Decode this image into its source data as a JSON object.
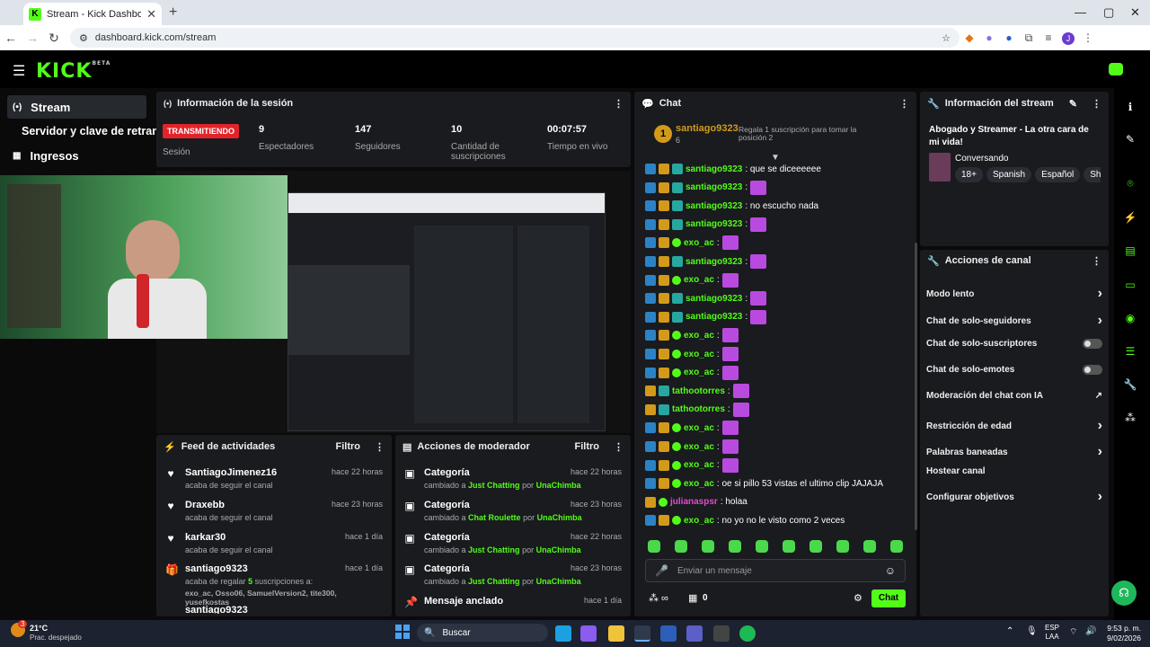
{
  "browser": {
    "tab_title": "Stream - Kick Dashboard",
    "url": "dashboard.kick.com/stream"
  },
  "kick": {
    "logo": "KICK",
    "logo_sup": "BETA"
  },
  "sidebar": {
    "items": [
      {
        "label": "Stream",
        "icon": "broadcast-icon"
      },
      {
        "label": "Servidor y clave de retransm",
        "icon": "server-icon"
      },
      {
        "label": "Ingresos",
        "icon": "chart-icon"
      }
    ]
  },
  "session": {
    "title": "Información de la sesión",
    "status": "TRANSMITIENDO",
    "status_label": "Sesión",
    "stats": [
      {
        "value": "9",
        "label": "Espectadores"
      },
      {
        "value": "147",
        "label": "Seguidores"
      },
      {
        "value": "10",
        "label": "Cantidad de suscripciones"
      },
      {
        "value": "00:07:57",
        "label": "Tiempo en vivo"
      }
    ]
  },
  "activity": {
    "title": "Feed de actividades",
    "filter": "Filtro",
    "items": [
      {
        "name": "SantiagoJimenez16",
        "sub": "acaba de seguir el canal",
        "time": "hace 22 horas"
      },
      {
        "name": "Draxebb",
        "sub": "acaba de seguir el canal",
        "time": "hace 23 horas"
      },
      {
        "name": "karkar30",
        "sub": "acaba de seguir el canal",
        "time": "hace 1 día"
      },
      {
        "name": "santiago9323",
        "sub": "acaba de regalar",
        "sub_count": "5",
        "sub_rest": "suscripciones a:",
        "gifted": "exo_ac, Osso06, SamuelVersion2, tite300, yusefkostas",
        "time": "hace 1 día"
      },
      {
        "name": "santiago9323"
      }
    ]
  },
  "modactions": {
    "title": "Acciones de moderador",
    "filter": "Filtro",
    "items": [
      {
        "name": "Categoría",
        "pre": "cambiado a",
        "what": "Just Chatting",
        "by": "por",
        "who": "UnaChimba",
        "time": "hace 22 horas"
      },
      {
        "name": "Categoría",
        "pre": "cambiado a",
        "what": "Chat Roulette",
        "by": "por",
        "who": "UnaChimba",
        "time": "hace 23 horas"
      },
      {
        "name": "Categoría",
        "pre": "cambiado a",
        "what": "Just Chatting",
        "by": "por",
        "who": "UnaChimba",
        "time": "hace 22 horas"
      },
      {
        "name": "Categoría",
        "pre": "cambiado a",
        "what": "Just Chatting",
        "by": "por",
        "who": "UnaChimba",
        "time": "hace 23 horas"
      },
      {
        "name": "Mensaje anclado",
        "time": "hace 1 día"
      }
    ]
  },
  "chat": {
    "title": "Chat",
    "top_rank": "1",
    "top_user": "santiago9323",
    "top_count": "6",
    "gift_prompt": "Regala 1 suscripción para tomar la posición 2",
    "messages": [
      {
        "user": "santiago9323",
        "text": ": que se diceeeeee",
        "color": "#53fc18"
      },
      {
        "user": "santiago9323",
        "text": ":",
        "color": "#53fc18"
      },
      {
        "user": "santiago9323",
        "text": ": no escucho nada",
        "color": "#53fc18"
      },
      {
        "user": "santiago9323",
        "text": ":",
        "color": "#53fc18"
      },
      {
        "user": "exo_ac",
        "text": ":",
        "color": "#53fc18"
      },
      {
        "user": "santiago9323",
        "text": ":",
        "color": "#53fc18"
      },
      {
        "user": "exo_ac",
        "text": ":",
        "color": "#53fc18"
      },
      {
        "user": "santiago9323",
        "text": ":",
        "color": "#53fc18"
      },
      {
        "user": "santiago9323",
        "text": ":",
        "color": "#53fc18"
      },
      {
        "user": "exo_ac",
        "text": ":",
        "color": "#53fc18"
      },
      {
        "user": "exo_ac",
        "text": ":",
        "color": "#53fc18"
      },
      {
        "user": "exo_ac",
        "text": ":",
        "color": "#53fc18"
      },
      {
        "user": "tathootorres",
        "text": ":",
        "color": "#53fc18"
      },
      {
        "user": "tathootorres",
        "text": ":",
        "color": "#53fc18"
      },
      {
        "user": "exo_ac",
        "text": ":",
        "color": "#53fc18"
      },
      {
        "user": "exo_ac",
        "text": ":",
        "color": "#53fc18"
      },
      {
        "user": "exo_ac",
        "text": ":",
        "color": "#53fc18"
      },
      {
        "user": "exo_ac",
        "text": ": oe si pillo 53 vistas el ultimo clip JAJAJA",
        "color": "#53fc18"
      },
      {
        "user": "julianaspsr",
        "text": ": holaa",
        "color": "#e34ad0"
      },
      {
        "user": "exo_ac",
        "text": ": no yo no le visto como 2 veces",
        "color": "#53fc18"
      }
    ],
    "input_placeholder": "Enviar un mensaje",
    "stat_count": "0",
    "send_label": "Chat"
  },
  "streaminfo": {
    "title": "Información del stream",
    "stream_title": "Abogado y Streamer - La otra cara de mi vida!",
    "category": "Conversando",
    "tags": [
      "18+",
      "Spanish",
      "Español",
      "Shoc"
    ]
  },
  "channel": {
    "title": "Acciones de canal",
    "items": [
      {
        "label": "Modo lento",
        "kind": "arrow"
      },
      {
        "label": "Chat de solo-seguidores",
        "kind": "arrow"
      },
      {
        "label": "Chat de solo-suscriptores",
        "kind": "toggle"
      },
      {
        "label": "Chat de solo-emotes",
        "kind": "toggle"
      },
      {
        "label": "Moderación del chat con IA",
        "kind": "ext"
      },
      {
        "label": "Restricción de edad",
        "kind": "arrow"
      },
      {
        "label": "Palabras baneadas",
        "kind": "arrow"
      },
      {
        "label": "Hostear canal",
        "kind": "none"
      },
      {
        "label": "Configurar objetivos",
        "kind": "arrow"
      }
    ]
  },
  "taskbar": {
    "temp": "21°C",
    "weather": "Prac. despejado",
    "search": "Buscar",
    "lang1": "ESP",
    "lang2": "LAA",
    "time": "9:53 p. m.",
    "date": "9/02/2026",
    "badge": "3"
  },
  "colors": {
    "accent": "#53fc18",
    "live": "#e3232a",
    "panel": "#191b1f"
  }
}
